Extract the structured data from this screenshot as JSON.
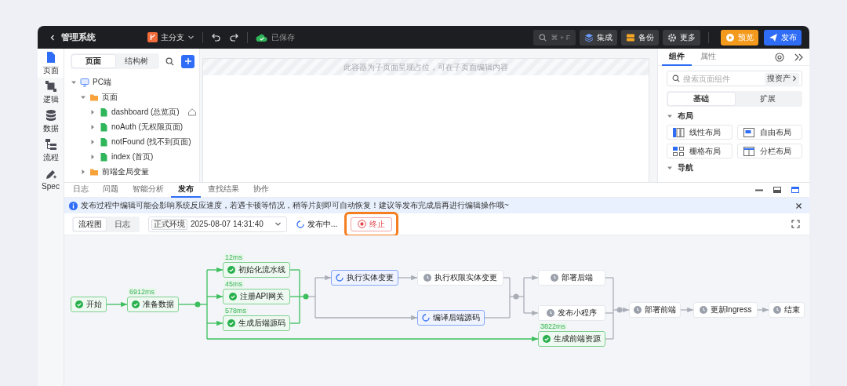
{
  "topbar": {
    "title": "管理系统",
    "branch": "主分支",
    "save_status": "已保存",
    "search_shortcut": "⌘ + F",
    "buttons": [
      {
        "label": "集成",
        "kind": "integrate"
      },
      {
        "label": "备份",
        "kind": "backup"
      },
      {
        "label": "更多",
        "kind": "more"
      },
      {
        "label": "预览",
        "kind": "preview"
      },
      {
        "label": "发布",
        "kind": "publish"
      }
    ]
  },
  "rail": [
    {
      "label": "页面",
      "kind": "page",
      "selected": true
    },
    {
      "label": "逻辑",
      "kind": "logic",
      "selected": false
    },
    {
      "label": "数据",
      "kind": "data",
      "selected": false
    },
    {
      "label": "流程",
      "kind": "flow",
      "selected": false
    },
    {
      "label": "Spec",
      "kind": "spec",
      "selected": false
    }
  ],
  "tree_panel": {
    "tabs": [
      {
        "label": "页面",
        "selected": true
      },
      {
        "label": "结构树",
        "selected": false
      }
    ],
    "tree": [
      {
        "label": "PC端",
        "kind": "device",
        "expanded": true,
        "children": [
          {
            "label": "页面",
            "kind": "folder",
            "expanded": true,
            "children": [
              {
                "label": "dashboard (总览页)",
                "kind": "page",
                "expanded": false,
                "home": true
              },
              {
                "label": "noAuth (无权限页面)",
                "kind": "page",
                "expanded": false,
                "home": false
              },
              {
                "label": "notFound (找不到页面)",
                "kind": "page",
                "expanded": false,
                "home": false
              },
              {
                "label": "index (首页)",
                "kind": "page",
                "expanded": false,
                "home": false
              }
            ]
          },
          {
            "label": "前端全局变量",
            "kind": "folder",
            "expanded": false
          }
        ]
      }
    ]
  },
  "canvas": {
    "placeholder_note": "此容器为子页面呈现占位，可在子页面编辑内容"
  },
  "component_panel": {
    "tabs": [
      {
        "label": "组件",
        "selected": true
      },
      {
        "label": "属性",
        "selected": false
      }
    ],
    "search": {
      "placeholder": "搜索页面组件",
      "asset_button": "搜资产"
    },
    "categories": [
      {
        "label": "基础",
        "selected": true
      },
      {
        "label": "扩展",
        "selected": false
      }
    ],
    "sections": [
      {
        "title": "布局",
        "expanded": true,
        "items": [
          {
            "label": "线性布局",
            "kind": "linear"
          },
          {
            "label": "自由布局",
            "kind": "free"
          },
          {
            "label": "栅格布局",
            "kind": "grid"
          },
          {
            "label": "分栏布局",
            "kind": "split"
          }
        ]
      },
      {
        "title": "导航",
        "expanded": true
      }
    ]
  },
  "bottom_panel": {
    "tabs": [
      {
        "label": "日志",
        "selected": false
      },
      {
        "label": "问题",
        "selected": false
      },
      {
        "label": "智能分析",
        "selected": false
      },
      {
        "label": "发布",
        "selected": true
      },
      {
        "label": "查找结果",
        "selected": false
      },
      {
        "label": "协作",
        "selected": false
      }
    ],
    "panel_size_buttons": [
      {
        "kind": "minimize",
        "selected": false
      },
      {
        "kind": "half",
        "selected": false
      },
      {
        "kind": "maximize",
        "selected": true
      }
    ],
    "notice": "发布过程中编辑可能会影响系统反应速度，若遇卡顿等情况，稍等片刻即可自动恢复！建议等发布完成后再进行编辑操作哦~",
    "toolbar": {
      "views": [
        {
          "label": "流程图",
          "selected": true
        },
        {
          "label": "日志",
          "selected": false
        }
      ],
      "environment": "正式环境",
      "timestamp": "2025-08-07 14:31:40",
      "status": "发布中...",
      "stop_button": "终止",
      "highlighted": true
    },
    "flow": {
      "nodes": [
        {
          "label": "开始",
          "kind": "done"
        },
        {
          "label": "准备数据",
          "kind": "done",
          "duration": "6912ms"
        },
        {
          "label": "初始化流水线",
          "kind": "done",
          "duration": "12ms"
        },
        {
          "label": "注册API网关",
          "kind": "done",
          "duration": "45ms"
        },
        {
          "label": "生成后端源码",
          "kind": "done",
          "duration": "578ms"
        },
        {
          "label": "执行实体变更",
          "kind": "running"
        },
        {
          "label": "执行权限实体变更",
          "kind": "pending"
        },
        {
          "label": "编译后端源码",
          "kind": "running"
        },
        {
          "label": "部署后端",
          "kind": "pending"
        },
        {
          "label": "发布小程序",
          "kind": "pending"
        },
        {
          "label": "生成前端资源",
          "kind": "done",
          "duration": "3822ms"
        },
        {
          "label": "部署前端",
          "kind": "pending"
        },
        {
          "label": "更新Ingress",
          "kind": "pending"
        },
        {
          "label": "结束",
          "kind": "pending"
        }
      ]
    }
  }
}
